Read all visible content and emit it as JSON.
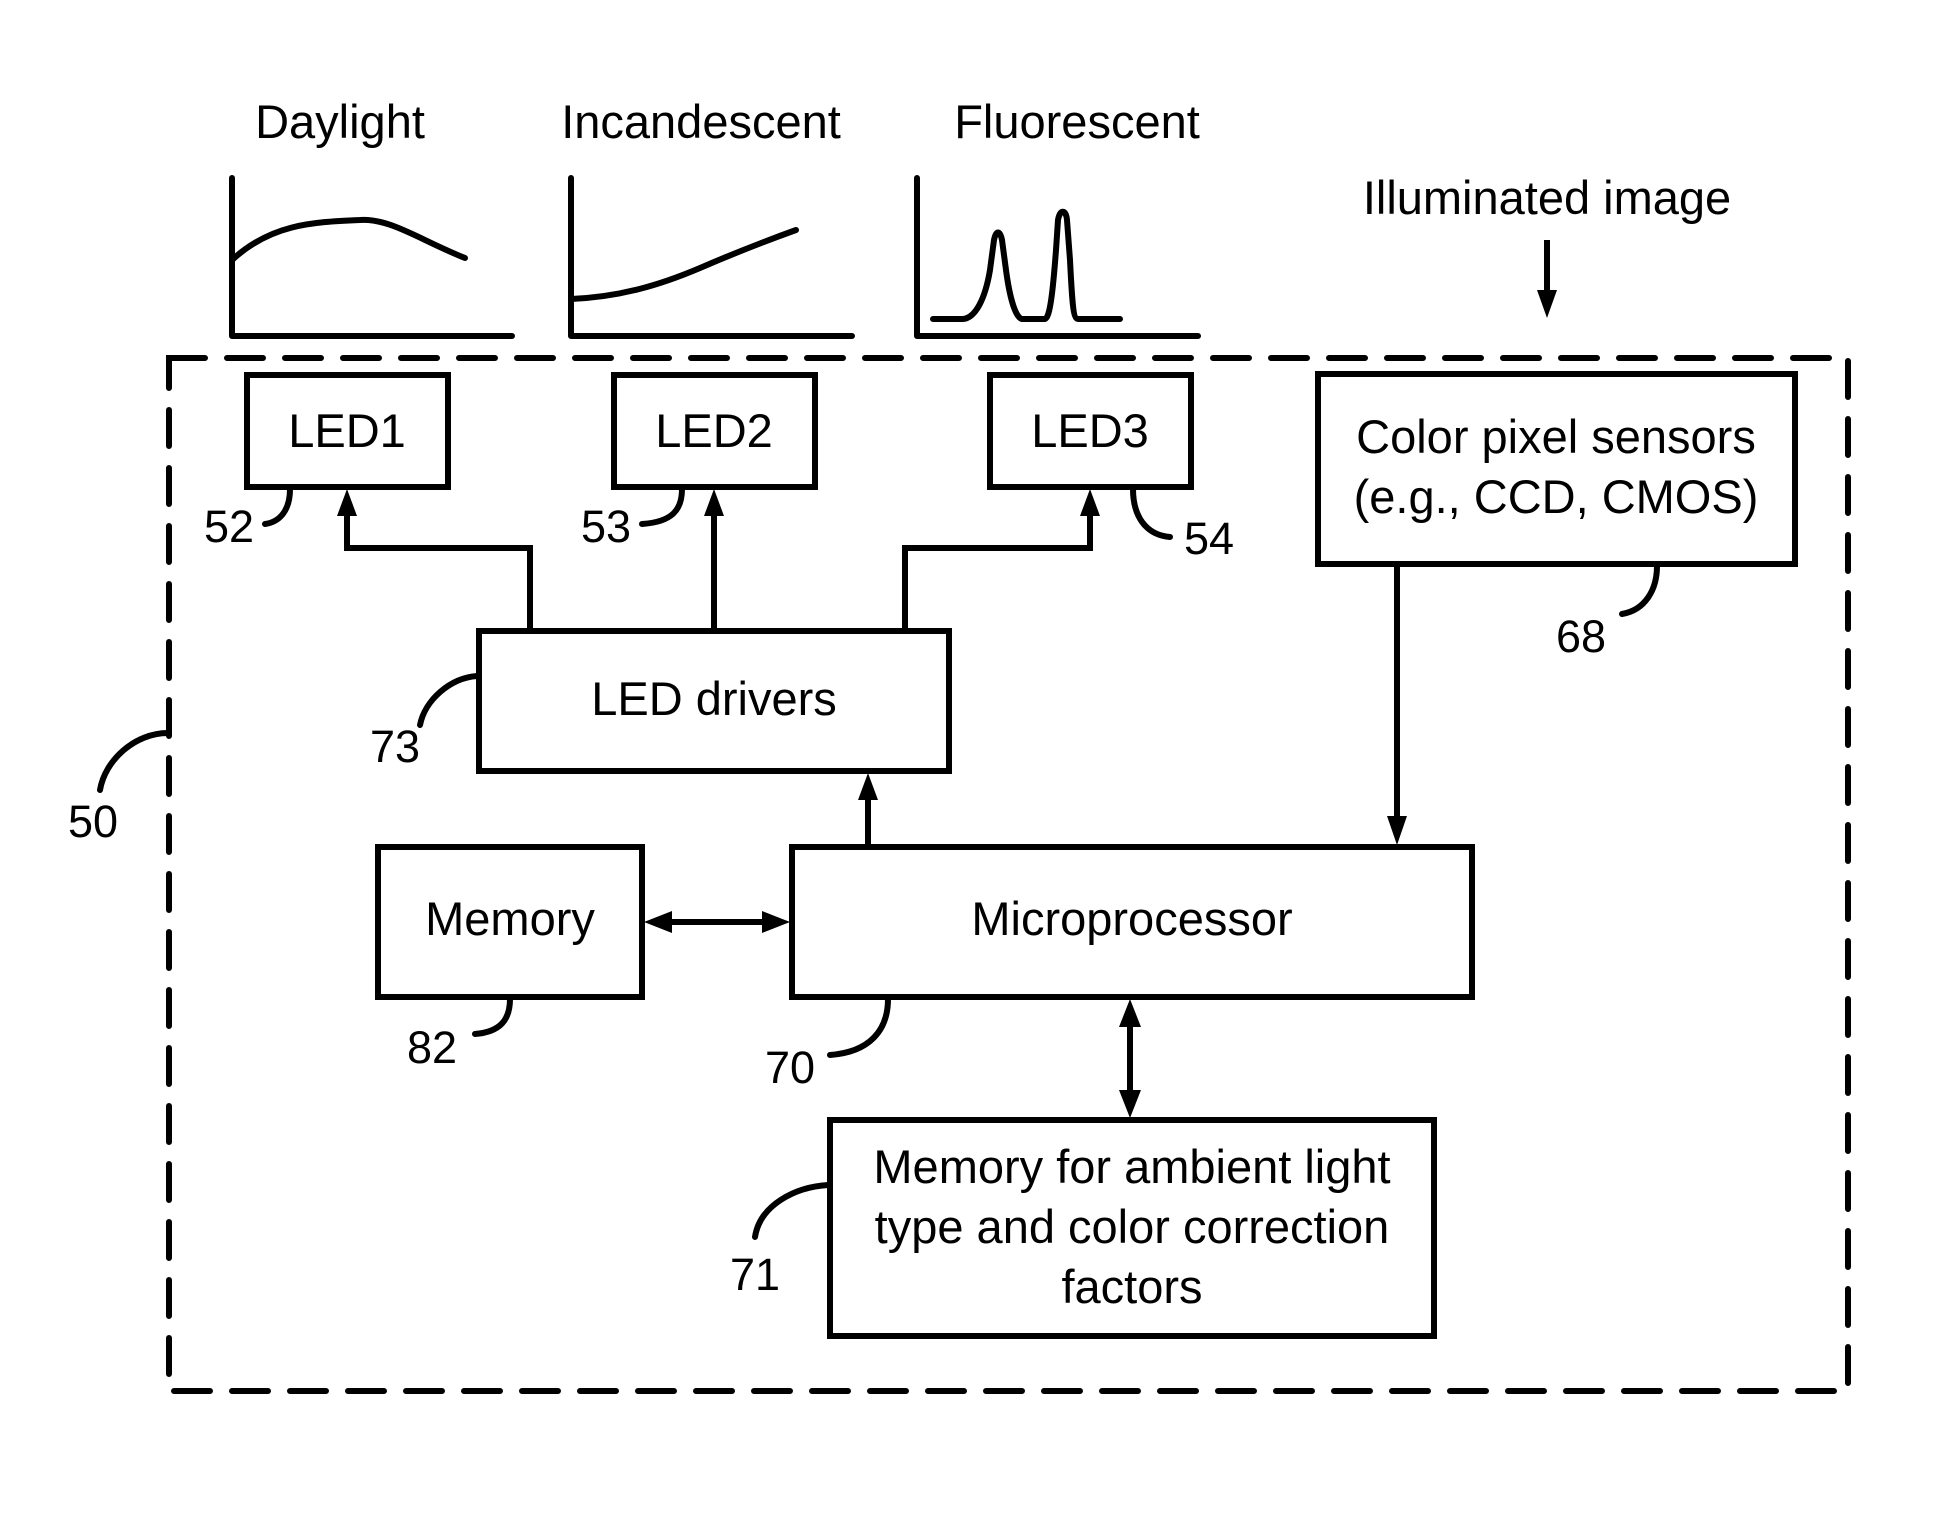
{
  "spectra": [
    {
      "title": "Daylight",
      "shape": "broad-hump"
    },
    {
      "title": "Incandescent",
      "shape": "rising"
    },
    {
      "title": "Fluorescent",
      "shape": "two-peaks"
    }
  ],
  "illuminated_label": "Illuminated image",
  "boundary_ref": "50",
  "blocks": {
    "led1": {
      "label": "LED1",
      "ref": "52"
    },
    "led2": {
      "label": "LED2",
      "ref": "53"
    },
    "led3": {
      "label": "LED3",
      "ref": "54"
    },
    "sensor": {
      "lines": [
        "Color pixel sensors",
        "(e.g., CCD, CMOS)"
      ],
      "ref": "68"
    },
    "drivers": {
      "label": "LED drivers",
      "ref": "73"
    },
    "memory": {
      "label": "Memory",
      "ref": "82"
    },
    "micro": {
      "label": "Microprocessor",
      "ref": "70"
    },
    "ambient": {
      "lines": [
        "Memory for ambient light",
        "type and color correction",
        "factors"
      ],
      "ref": "71"
    }
  },
  "connections": [
    {
      "from": "LED drivers",
      "to": "LED1",
      "direction": "one-way"
    },
    {
      "from": "LED drivers",
      "to": "LED2",
      "direction": "one-way"
    },
    {
      "from": "LED drivers",
      "to": "LED3",
      "direction": "one-way"
    },
    {
      "from": "Microprocessor",
      "to": "LED drivers",
      "direction": "one-way"
    },
    {
      "from": "Color pixel sensors",
      "to": "Microprocessor",
      "direction": "one-way"
    },
    {
      "from": "Memory",
      "to": "Microprocessor",
      "direction": "two-way"
    },
    {
      "from": "Microprocessor",
      "to": "Memory for ambient light type and color correction factors",
      "direction": "two-way"
    }
  ]
}
